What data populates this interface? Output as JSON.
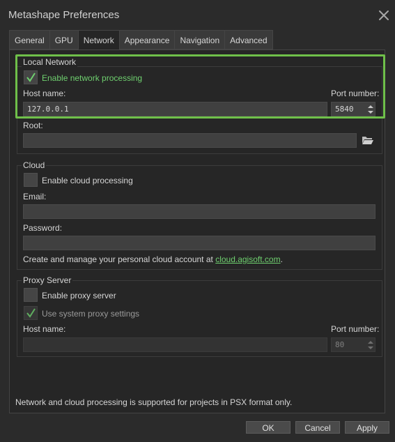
{
  "window": {
    "title": "Metashape Preferences"
  },
  "tabs": [
    {
      "label": "General"
    },
    {
      "label": "GPU"
    },
    {
      "label": "Network"
    },
    {
      "label": "Appearance"
    },
    {
      "label": "Navigation"
    },
    {
      "label": "Advanced"
    }
  ],
  "active_tab": "Network",
  "local_network": {
    "title": "Local Network",
    "enable_label": "Enable network processing",
    "enable_checked": true,
    "host_label": "Host name:",
    "host_value": "127.0.0.1",
    "port_label": "Port number:",
    "port_value": "5840",
    "root_label": "Root:",
    "root_value": ""
  },
  "cloud": {
    "title": "Cloud",
    "enable_label": "Enable cloud processing",
    "enable_checked": false,
    "email_label": "Email:",
    "email_value": "",
    "password_label": "Password:",
    "password_value": "",
    "info_text": "Create and manage your personal cloud account at ",
    "info_link": "cloud.agisoft.com",
    "info_suffix": "."
  },
  "proxy": {
    "title": "Proxy Server",
    "enable_label": "Enable proxy server",
    "enable_checked": false,
    "system_label": "Use system proxy settings",
    "system_checked": true,
    "host_label": "Host name:",
    "host_value": "",
    "port_label": "Port number:",
    "port_value": "80"
  },
  "footer_note": "Network and cloud processing is supported for projects in PSX format only.",
  "buttons": {
    "ok": "OK",
    "cancel": "Cancel",
    "apply": "Apply"
  },
  "colors": {
    "highlight": "#6fc04a",
    "link": "#6fd06f",
    "check": "#6fd06f"
  },
  "icons": {
    "close": "close-icon",
    "folder": "folder-icon",
    "check": "checkmark-icon"
  }
}
